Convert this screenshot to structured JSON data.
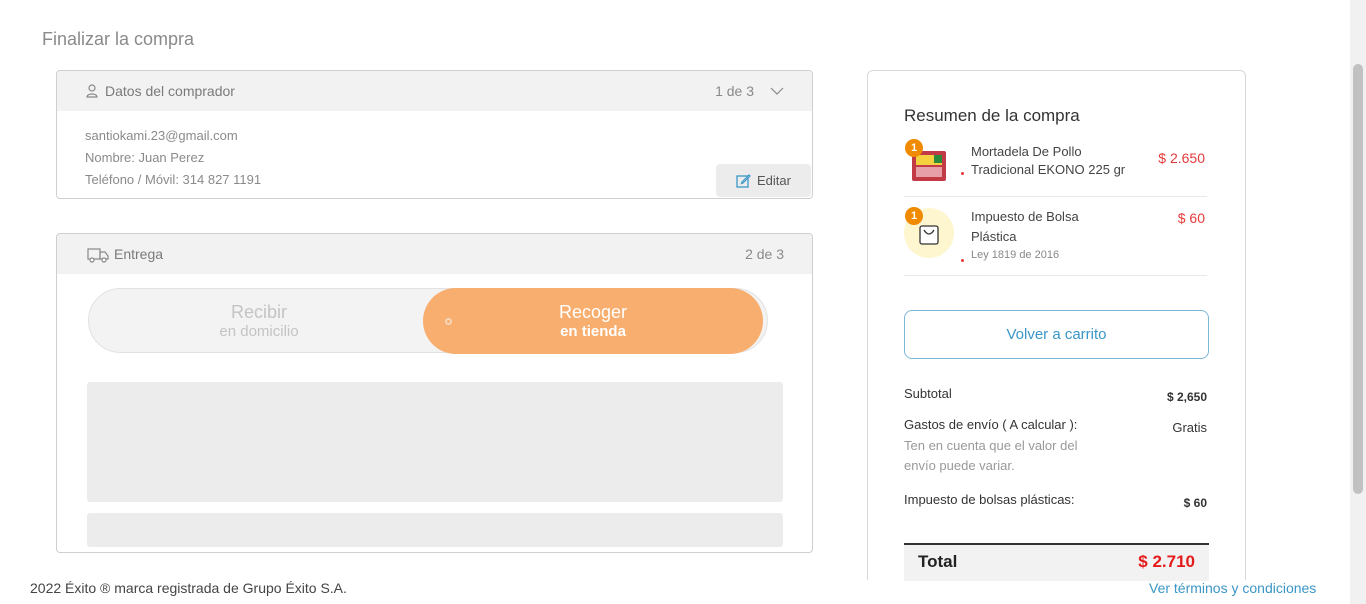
{
  "page_title": "Finalizar la compra",
  "buyer": {
    "title": "Datos del comprador",
    "step": "1 de 3",
    "email": "santiokami.23@gmail.com",
    "name": "Nombre: Juan Perez",
    "phone": "Teléfono / Móvil: 314 827 1191",
    "edit_label": "Editar"
  },
  "delivery": {
    "title": "Entrega",
    "step": "2 de 3",
    "option_home_line1": "Recibir",
    "option_home_line2": "en domicilio",
    "option_store_line1": "Recoger",
    "option_store_line2": "en tienda"
  },
  "summary": {
    "title": "Resumen de la compra",
    "items": [
      {
        "qty": "1",
        "name_line1": "Mortadela De Pollo",
        "name_line2": "Tradicional EKONO 225 gr",
        "price": "$ 2.650"
      },
      {
        "qty": "1",
        "name_line1": "Impuesto de Bolsa",
        "name_line2": "Plástica",
        "sub": "Ley 1819 de 2016",
        "price": "$ 60"
      }
    ],
    "back_button": "Volver a carrito",
    "subtotal_label": "Subtotal",
    "subtotal_value": "$ 2,650",
    "shipping_label": "Gastos de envío ( A calcular ):",
    "shipping_value": "Gratis",
    "shipping_note": "Ten en cuenta que el valor del envío puede variar.",
    "bags_label": "Impuesto de bolsas plásticas:",
    "bags_value": "$ 60",
    "total_label": "Total",
    "total_value": "$ 2.710"
  },
  "footer": {
    "copyright": "2022 Éxito ® marca registrada de Grupo Éxito S.A.",
    "terms_link": "Ver términos y condiciones"
  },
  "colors": {
    "accent_orange": "#f8ae6e",
    "price_red": "#e43b3b",
    "link_blue": "#3b96c7"
  }
}
